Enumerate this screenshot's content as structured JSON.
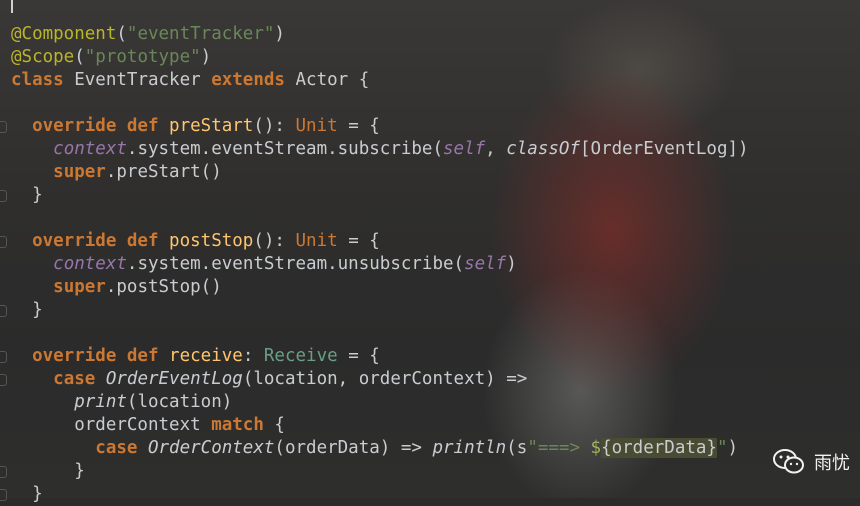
{
  "editor": {
    "lines": [
      {
        "segments": []
      },
      {
        "segments": [
          {
            "t": "@Component",
            "c": "ann"
          },
          {
            "t": "(",
            "c": "sp"
          },
          {
            "t": "\"eventTracker\"",
            "c": "str"
          },
          {
            "t": ")",
            "c": "sp"
          }
        ]
      },
      {
        "segments": [
          {
            "t": "@Scope",
            "c": "ann"
          },
          {
            "t": "(",
            "c": "sp"
          },
          {
            "t": "\"prototype\"",
            "c": "str"
          },
          {
            "t": ")",
            "c": "sp"
          }
        ]
      },
      {
        "segments": [
          {
            "t": "class",
            "c": "kw"
          },
          {
            "t": " EventTracker ",
            "c": "sp"
          },
          {
            "t": "extends",
            "c": "kw"
          },
          {
            "t": " Actor {",
            "c": "sp"
          }
        ]
      },
      {
        "segments": []
      },
      {
        "gutter": true,
        "segments": [
          {
            "t": "  override def ",
            "c": "kw"
          },
          {
            "t": "preStart",
            "c": "fn"
          },
          {
            "t": "(): ",
            "c": "sp"
          },
          {
            "t": "Unit",
            "c": "type"
          },
          {
            "t": " = {",
            "c": "sp"
          }
        ]
      },
      {
        "segments": [
          {
            "t": "    ",
            "c": "sp"
          },
          {
            "t": "context",
            "c": "it"
          },
          {
            "t": ".system.eventStream.subscribe(",
            "c": "sp"
          },
          {
            "t": "self",
            "c": "it"
          },
          {
            "t": ", ",
            "c": "sp"
          },
          {
            "t": "classOf",
            "c": "itp"
          },
          {
            "t": "[OrderEventLog])",
            "c": "sp"
          }
        ]
      },
      {
        "segments": [
          {
            "t": "    ",
            "c": "sp"
          },
          {
            "t": "super",
            "c": "kw"
          },
          {
            "t": ".preStart()",
            "c": "sp"
          }
        ]
      },
      {
        "gutter": true,
        "segments": [
          {
            "t": "  }",
            "c": "sp"
          }
        ]
      },
      {
        "segments": []
      },
      {
        "gutter": true,
        "segments": [
          {
            "t": "  override def ",
            "c": "kw"
          },
          {
            "t": "postStop",
            "c": "fn"
          },
          {
            "t": "(): ",
            "c": "sp"
          },
          {
            "t": "Unit",
            "c": "type"
          },
          {
            "t": " = {",
            "c": "sp"
          }
        ]
      },
      {
        "segments": [
          {
            "t": "    ",
            "c": "sp"
          },
          {
            "t": "context",
            "c": "it"
          },
          {
            "t": ".system.eventStream.unsubscribe(",
            "c": "sp"
          },
          {
            "t": "self",
            "c": "it"
          },
          {
            "t": ")",
            "c": "sp"
          }
        ]
      },
      {
        "segments": [
          {
            "t": "    ",
            "c": "sp"
          },
          {
            "t": "super",
            "c": "kw"
          },
          {
            "t": ".postStop()",
            "c": "sp"
          }
        ]
      },
      {
        "gutter": true,
        "segments": [
          {
            "t": "  }",
            "c": "sp"
          }
        ]
      },
      {
        "segments": []
      },
      {
        "gutter": true,
        "segments": [
          {
            "t": "  override def ",
            "c": "kw"
          },
          {
            "t": "receive",
            "c": "fn"
          },
          {
            "t": ": ",
            "c": "sp"
          },
          {
            "t": "Receive",
            "c": "typed"
          },
          {
            "t": " = {",
            "c": "sp"
          }
        ]
      },
      {
        "gutter": true,
        "segments": [
          {
            "t": "    ",
            "c": "sp"
          },
          {
            "t": "case ",
            "c": "kw"
          },
          {
            "t": "OrderEventLog",
            "c": "itp"
          },
          {
            "t": "(location, orderContext) =>",
            "c": "sp"
          }
        ]
      },
      {
        "segments": [
          {
            "t": "      ",
            "c": "sp"
          },
          {
            "t": "print",
            "c": "itp"
          },
          {
            "t": "(location)",
            "c": "sp"
          }
        ]
      },
      {
        "segments": [
          {
            "t": "      orderContext ",
            "c": "sp"
          },
          {
            "t": "match",
            "c": "kw"
          },
          {
            "t": " {",
            "c": "sp"
          }
        ]
      },
      {
        "segments": [
          {
            "t": "        ",
            "c": "sp"
          },
          {
            "t": "case ",
            "c": "kw"
          },
          {
            "t": "OrderContext",
            "c": "itp"
          },
          {
            "t": "(orderData) => ",
            "c": "sp"
          },
          {
            "t": "println",
            "c": "itp"
          },
          {
            "t": "(s",
            "c": "sp"
          },
          {
            "t": "\"===> ",
            "c": "str"
          },
          {
            "t": "$",
            "c": "ip"
          },
          {
            "t": "{orderData}",
            "c": "hl"
          },
          {
            "t": "\"",
            "c": "str"
          },
          {
            "t": ")",
            "c": "sp"
          }
        ]
      },
      {
        "gutter": true,
        "segments": [
          {
            "t": "      }",
            "c": "sp"
          }
        ]
      },
      {
        "gutter": true,
        "segments": [
          {
            "t": "  }",
            "c": "sp"
          }
        ]
      }
    ]
  },
  "watermark": {
    "icon": "wechat-icon",
    "label": "雨忧"
  }
}
